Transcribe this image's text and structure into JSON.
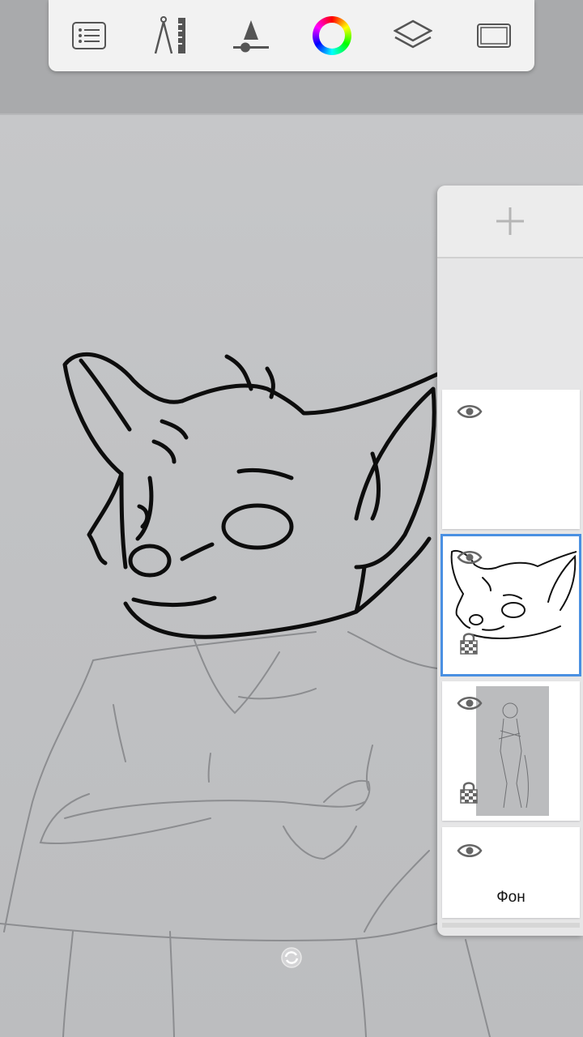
{
  "toolbar": {
    "items": [
      {
        "name": "list-menu-icon"
      },
      {
        "name": "ruler-compass-icon"
      },
      {
        "name": "brush-size-icon"
      },
      {
        "name": "color-wheel-icon"
      },
      {
        "name": "layers-icon"
      },
      {
        "name": "fullscreen-icon"
      }
    ]
  },
  "layers": {
    "add_icon": "plus-icon",
    "items": [
      {
        "visible": true,
        "locked": false,
        "selected": false,
        "name": ""
      },
      {
        "visible": true,
        "locked": true,
        "selected": true,
        "name": ""
      },
      {
        "visible": true,
        "locked": true,
        "selected": false,
        "name": ""
      },
      {
        "visible": true,
        "locked": false,
        "selected": false,
        "name": "Фон"
      }
    ]
  },
  "colors": {
    "accent": "#4a90e2",
    "toolbar_bg": "#f2f2f2",
    "paper": "#c3c4c6"
  }
}
